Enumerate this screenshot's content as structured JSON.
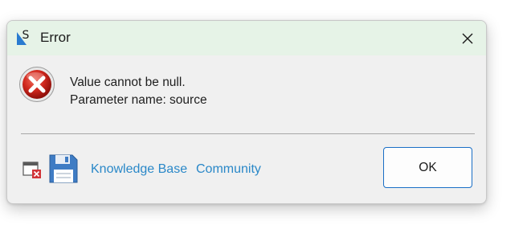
{
  "window": {
    "title": "Error",
    "app_icon": "s-logo-icon",
    "close_icon": "close-icon"
  },
  "message": {
    "icon": "error-icon",
    "line1": "Value cannot be null.",
    "line2": "Parameter name: source"
  },
  "footer": {
    "icons": [
      "window-error-icon",
      "floppy-disk-icon"
    ],
    "links": {
      "knowledge_base": "Knowledge Base",
      "community": "Community"
    },
    "ok_label": "OK"
  },
  "colors": {
    "titlebar_bg": "#e6f3e7",
    "dialog_bg": "#f0f0f0",
    "link": "#2a88c8",
    "error_red": "#c42b1c",
    "ok_border": "#1a6fc6"
  }
}
